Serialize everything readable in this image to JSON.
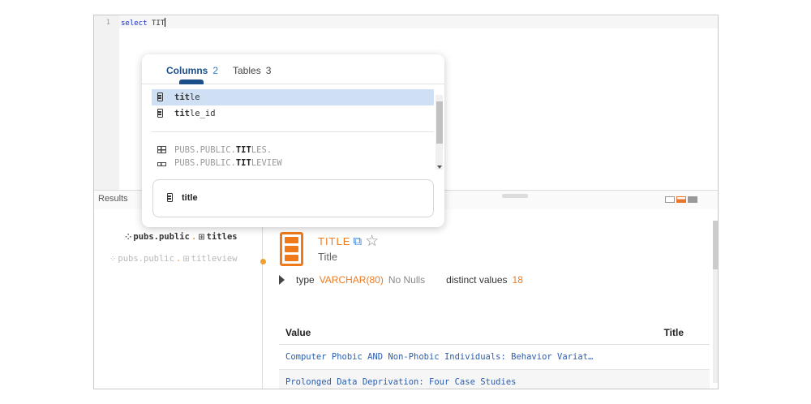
{
  "editor": {
    "line_number": "1",
    "keyword": "select",
    "typed_text": "TIT"
  },
  "results_bar": {
    "label": "Results"
  },
  "tree": {
    "items": [
      {
        "schema": "pubs.public",
        "sep": ".",
        "table": "titles",
        "state": "active"
      },
      {
        "schema": "pubs.public",
        "sep": ".",
        "table": "titleview",
        "state": "muted"
      }
    ]
  },
  "detail": {
    "title": "TITLE",
    "subtitle": "Title",
    "type_label": "type",
    "type_value": "VARCHAR(80)",
    "nulls": "No Nulls",
    "distinct_label": "distinct values",
    "distinct_value": "18",
    "table": {
      "headers": [
        "Value",
        "Title"
      ],
      "rows": [
        "Computer Phobic AND Non-Phobic Individuals: Behavior Variat…",
        "Prolonged Data Deprivation: Four Case Studies"
      ]
    }
  },
  "popup": {
    "tabs": [
      {
        "label": "Columns",
        "count": "2"
      },
      {
        "label": "Tables",
        "count": "3"
      }
    ],
    "columns": [
      {
        "match": "tit",
        "rest": "le"
      },
      {
        "match": "tit",
        "rest": "le_id"
      }
    ],
    "tables": [
      {
        "prefix": "PUBS.PUBLIC.",
        "match": "TIT",
        "rest": "LES."
      },
      {
        "prefix": "PUBS.PUBLIC.",
        "match": "TIT",
        "rest": "LEVIEW"
      }
    ],
    "preview_label": "title"
  },
  "colors": {
    "accent_orange": "#f07a1a",
    "accent_blue": "#1c4e89",
    "selection": "#cfe0f5",
    "link": "#2a5db0"
  }
}
